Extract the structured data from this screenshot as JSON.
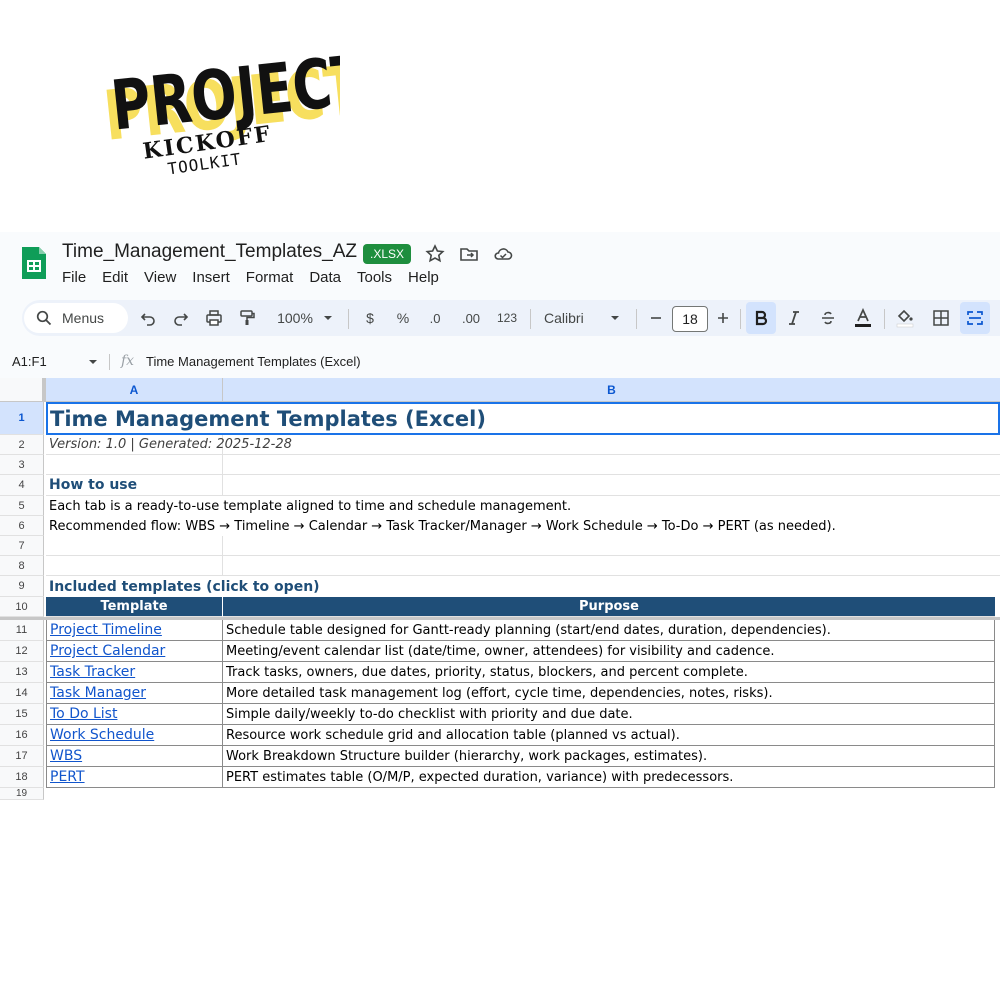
{
  "logo": {
    "line1": "PROJECT",
    "line2": "KICKOFF",
    "line3": "TOOLKIT"
  },
  "doc": {
    "title": "Time_Management_Templates_AZ",
    "badge": ".XLSX"
  },
  "menu": [
    "File",
    "Edit",
    "View",
    "Insert",
    "Format",
    "Data",
    "Tools",
    "Help"
  ],
  "toolbar": {
    "search_label": "Menus",
    "zoom": "100%",
    "currency": "$",
    "percent": "%",
    "dec_decrease": ".0",
    "dec_increase": ".00",
    "number_format": "123",
    "font": "Calibri",
    "font_size": "18"
  },
  "formula_bar": {
    "range": "A1:F1",
    "fx": "fx",
    "content": "Time Management Templates (Excel)"
  },
  "columns": [
    "A",
    "B"
  ],
  "rows": {
    "r1": {
      "num": "1",
      "text": "Time Management Templates (Excel)"
    },
    "r2": {
      "num": "2",
      "text": "Version: 1.0   |   Generated: 2025-12-28"
    },
    "r3": {
      "num": "3"
    },
    "r4": {
      "num": "4",
      "text": "How to use"
    },
    "r5": {
      "num": "5",
      "text": "Each tab is a ready-to-use template aligned to time and schedule management."
    },
    "r6": {
      "num": "6",
      "text": "Recommended flow: WBS → Timeline → Calendar → Task Tracker/Manager → Work Schedule → To-Do → PERT (as needed)."
    },
    "r7": {
      "num": "7"
    },
    "r8": {
      "num": "8"
    },
    "r9": {
      "num": "9",
      "text": "Included templates (click to open)"
    },
    "r10": {
      "num": "10",
      "a": "Template",
      "b": "Purpose"
    }
  },
  "templates": [
    {
      "num": "11",
      "name": "Project Timeline",
      "purpose": "Schedule table designed for Gantt-ready planning (start/end dates, duration, dependencies)."
    },
    {
      "num": "12",
      "name": "Project Calendar",
      "purpose": "Meeting/event calendar list (date/time, owner, attendees) for visibility and cadence."
    },
    {
      "num": "13",
      "name": "Task Tracker",
      "purpose": "Track tasks, owners, due dates, priority, status, blockers, and percent complete."
    },
    {
      "num": "14",
      "name": "Task Manager",
      "purpose": "More detailed task management log (effort, cycle time, dependencies, notes, risks)."
    },
    {
      "num": "15",
      "name": "To Do List",
      "purpose": "Simple daily/weekly to-do checklist with priority and due date."
    },
    {
      "num": "16",
      "name": "Work Schedule",
      "purpose": "Resource work schedule grid and allocation table (planned vs actual)."
    },
    {
      "num": "17",
      "name": "WBS",
      "purpose": "Work Breakdown Structure builder (hierarchy, work packages, estimates)."
    },
    {
      "num": "18",
      "name": "PERT",
      "purpose": "PERT estimates table (O/M/P, expected duration, variance) with predecessors."
    }
  ],
  "colors": {
    "header_fill": "#1f4e78",
    "title_blue": "#1f4e78",
    "link": "#1155cc",
    "badge_green": "#1e8e3e",
    "selection": "#d3e3fd"
  }
}
